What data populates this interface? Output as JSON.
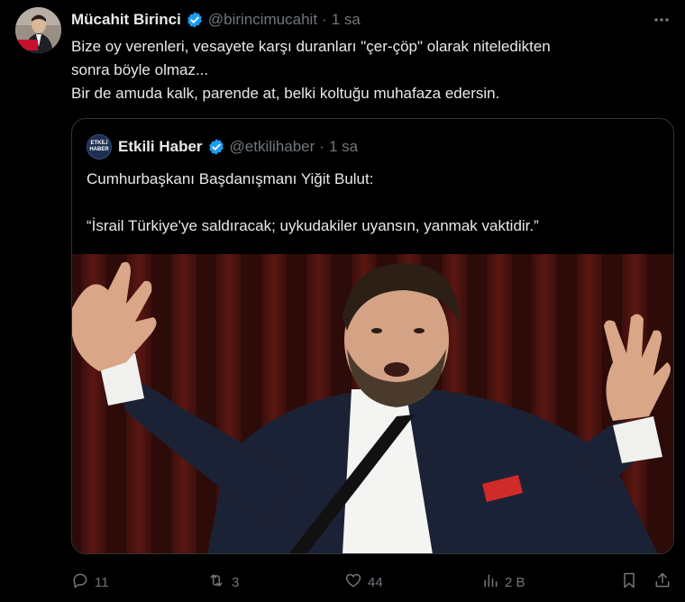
{
  "author": {
    "name": "Mücahit Birinci",
    "handle": "@birincimucahit",
    "separator": "·",
    "time": "1 sa"
  },
  "tweet_lines": [
    "Bize oy verenleri, vesayete karşı duranları \"çer-çöp\" olarak niteledikten",
    "sonra böyle olmaz...",
    "Bir de amuda kalk, parende at, belki koltuğu muhafaza edersin."
  ],
  "quote": {
    "avatar_text_line1": "ETKİLİ",
    "avatar_text_line2": "HABER",
    "name": "Etkili Haber",
    "handle": "@etkilihaber",
    "separator": "·",
    "time": "1 sa",
    "line1": "Cumhurbaşkanı Başdanışmanı Yiğit Bulut:",
    "line2": "“İsrail Türkiye'ye saldıracak; uykudakiler uyansın, yanmak vaktidir.”"
  },
  "actions": {
    "replies": "11",
    "reposts": "3",
    "likes": "44",
    "views": "2 B"
  },
  "colors": {
    "background": "#000000",
    "text": "#e7e9ea",
    "muted": "#71767b",
    "verified": "#1d9bf0",
    "border": "#2f3336"
  },
  "icons": [
    "more-icon",
    "verified-icon",
    "reply-icon",
    "repost-icon",
    "like-icon",
    "views-icon",
    "bookmark-icon",
    "share-icon"
  ]
}
